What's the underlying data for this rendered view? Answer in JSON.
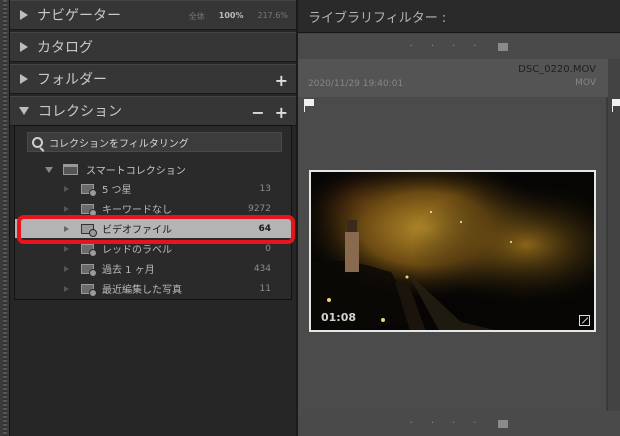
{
  "panels": {
    "navigator": {
      "label": "ナビゲーター",
      "zoom": [
        "全体",
        "100%",
        "217.6%"
      ]
    },
    "catalog": {
      "label": "カタログ"
    },
    "folders": {
      "label": "フォルダー",
      "add": "+"
    },
    "collections": {
      "label": "コレクション",
      "minus": "−",
      "add": "+"
    }
  },
  "collections": {
    "filter_placeholder": "コレクションをフィルタリング",
    "smart_collection": "スマートコレクション",
    "items": [
      {
        "label": "5 つ星",
        "count": "13"
      },
      {
        "label": "キーワードなし",
        "count": "9272"
      },
      {
        "label": "ビデオファイル",
        "count": "64"
      },
      {
        "label": "レッドのラベル",
        "count": "0"
      },
      {
        "label": "過去 1 ヶ月",
        "count": "434"
      },
      {
        "label": "最近編集した写真",
        "count": "11"
      }
    ],
    "selected_index": 2
  },
  "library": {
    "filter_title": "ライブラリフィルター :",
    "cell": {
      "timestamp": "2020/11/29 19:40:01",
      "filename": "DSC_0220.MOV",
      "ext": "MOV",
      "duration": "01:08"
    }
  },
  "colors": {
    "highlight": "#e8141b",
    "selected_row": "#b4b4b4"
  }
}
